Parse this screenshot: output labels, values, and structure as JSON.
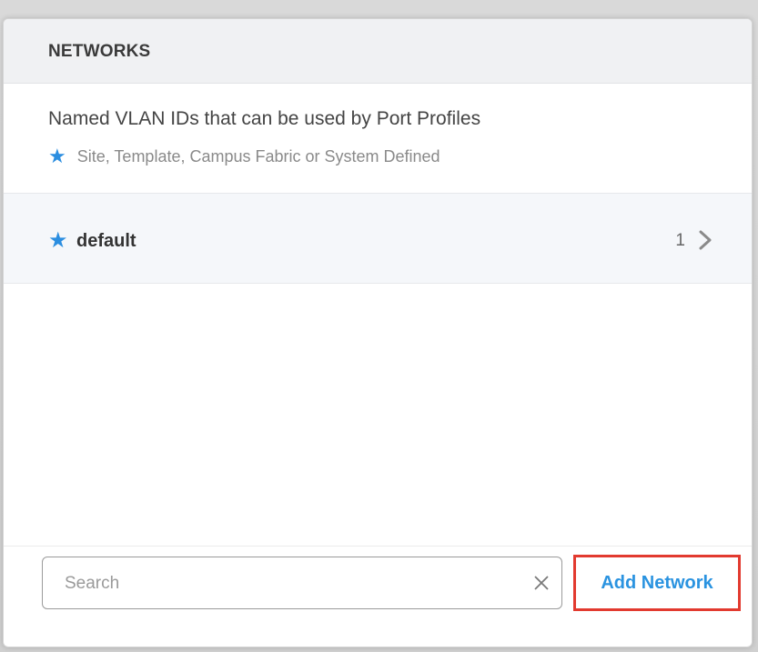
{
  "panel": {
    "title": "NETWORKS",
    "description": "Named VLAN IDs that can be used by Port Profiles",
    "legend": "Site, Template, Campus Fabric or System Defined"
  },
  "list": {
    "items": [
      {
        "label": "default",
        "count": "1",
        "marker": "★"
      }
    ]
  },
  "footer": {
    "search": {
      "placeholder": "Search",
      "value": ""
    },
    "add_button_label": "Add Network"
  },
  "colors": {
    "accent": "#2b8ee0",
    "highlight_border": "#e23a2f",
    "header_bg": "#f0f1f3",
    "list_item_bg": "#f5f7fa"
  },
  "icons": {
    "marker": "star-icon",
    "row_nav": "chevron-right-icon",
    "clear": "close-icon"
  }
}
